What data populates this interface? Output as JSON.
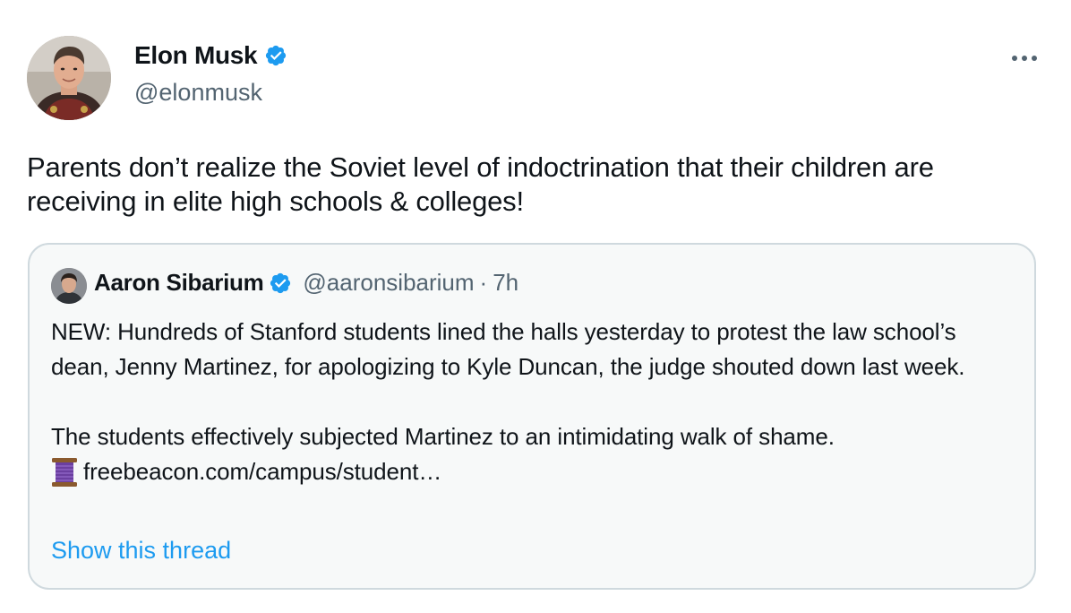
{
  "author": {
    "display_name": "Elon Musk",
    "handle": "@elonmusk",
    "verified": true,
    "avatar_icon": "profile-photo"
  },
  "tweet": {
    "text": "Parents don’t realize the Soviet level of indoctrination that their children are receiving in elite high schools & colleges!"
  },
  "more_icon": "more-horizontal-icon",
  "quoted_tweet": {
    "author": {
      "display_name": "Aaron Sibarium",
      "handle": "@aaronsibarium",
      "separator": "·",
      "time": "7h",
      "verified": true
    },
    "paragraph_1": "NEW: Hundreds of Stanford students lined the halls yesterday to protest the law school’s dean, Jenny Martinez, for apologizing to Kyle Duncan, the judge shouted down last week.",
    "paragraph_2": "The students effectively subjected Martinez to an intimidating walk of shame.",
    "emoji_icon": "thread-spool-icon",
    "link_text": "freebeacon.com/campus/student…",
    "show_thread_label": "Show this thread"
  },
  "colors": {
    "verified_blue": "#1d9bf0",
    "link_blue": "#1d9bf0",
    "secondary_text": "#536471",
    "border": "#cfd9de",
    "quote_bg": "#f7f9f9"
  }
}
